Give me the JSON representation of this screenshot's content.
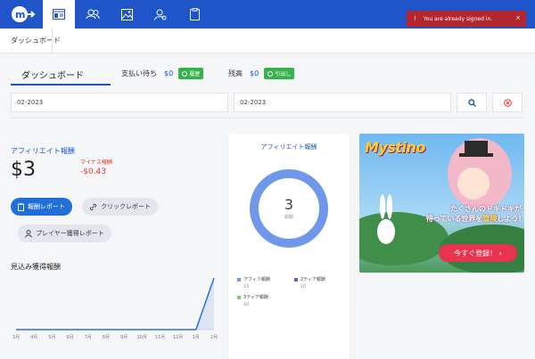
{
  "topbar": {
    "color": "#1f55c8",
    "nav_icons": [
      "dashboard-icon",
      "users-icon",
      "image-icon",
      "user-settings-icon",
      "clipboard-icon"
    ]
  },
  "breadcrumb": "ダッシュボード",
  "toast": {
    "message": "You are already signed in.",
    "close": "×",
    "color": "#b3262e"
  },
  "tabs": {
    "dashboard_label": "ダッシュボード",
    "pending": {
      "label": "支払い待ち",
      "value": "$0",
      "button": "履歴"
    },
    "balance": {
      "label": "残高",
      "value": "$0",
      "button": "引出し"
    }
  },
  "filters": {
    "from": "02-2023",
    "to": "02-2023"
  },
  "affiliate": {
    "title": "アフィリエイト報酬",
    "value": "$3",
    "minus_title": "マイナス報酬",
    "minus_value": "-$0.43"
  },
  "buttons": {
    "report": "報酬レポート",
    "click_report": "クリックレポート",
    "player_report": "プレイヤー獲得レポート"
  },
  "projection": {
    "title": "見込み獲得報酬"
  },
  "chart_data": {
    "type": "line",
    "categories": [
      "3月",
      "4月",
      "5月",
      "6月",
      "7月",
      "8月",
      "9月",
      "10月",
      "11月",
      "12月",
      "1月",
      "2月"
    ],
    "values": [
      0,
      0,
      0,
      0,
      0,
      0,
      0,
      0,
      0,
      0,
      0,
      3
    ],
    "title": "見込み獲得報酬",
    "xlabel": "",
    "ylabel": "",
    "color": "#2f6fe0"
  },
  "donut_card": {
    "title": "アフィリエイト報酬",
    "center_value": "3",
    "center_label": "報酬",
    "ring_color": "#6f98ea",
    "legend": [
      {
        "name": "アフィリ報酬",
        "value": "$3",
        "color": "#6f98ea"
      },
      {
        "name": "2ティア報酬",
        "value": "$0",
        "color": "#6b5bd6"
      },
      {
        "name": "3ティア報酬",
        "value": "$0",
        "color": "#7bd06a"
      }
    ]
  },
  "ad": {
    "brand": "Mystino",
    "copy_line1": "たくさんのドキドキが",
    "copy_line2a": "待っている世界を",
    "copy_line2b": "冒険",
    "copy_line2c": "しよう!",
    "cta": "今すぐ登録！ ›"
  }
}
